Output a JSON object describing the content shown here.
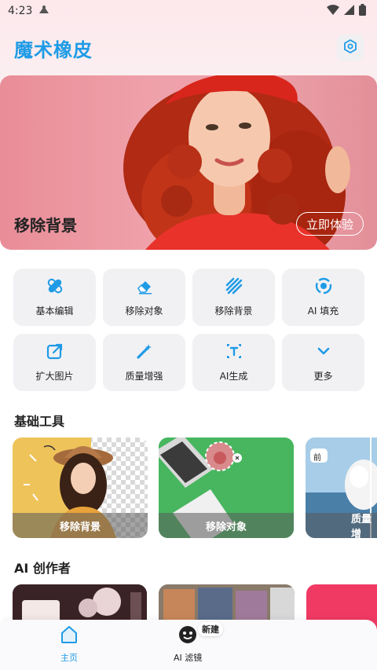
{
  "status_bar": {
    "time": "4:23"
  },
  "header": {
    "title": "魔术橡皮"
  },
  "banner": {
    "title": "移除背景",
    "button_label": "立即体验"
  },
  "tools_grid": [
    {
      "label": "基本编辑",
      "icon": "bandage-icon"
    },
    {
      "label": "移除对象",
      "icon": "eraser-icon"
    },
    {
      "label": "移除背景",
      "icon": "stripes-icon"
    },
    {
      "label": "AI 填充",
      "icon": "fill-icon"
    },
    {
      "label": "扩大图片",
      "icon": "expand-icon"
    },
    {
      "label": "质量增强",
      "icon": "magic-wand-icon"
    },
    {
      "label": "AI生成",
      "icon": "text-cursor-icon"
    },
    {
      "label": "更多",
      "icon": "chevron-down-icon"
    }
  ],
  "basic_tools": {
    "title": "基础工具",
    "cards": [
      {
        "label": "移除背景"
      },
      {
        "label": "移除对象"
      },
      {
        "label": "质量增",
        "before_tag": "前"
      }
    ]
  },
  "ai_creator": {
    "title": "AI 创作者"
  },
  "bottom_nav": {
    "home_label": "主页",
    "filters_label": "AI 滤镜",
    "new_badge": "新建"
  },
  "colors": {
    "accent": "#1f9be6",
    "banner": "#eba1a8",
    "green": "#47b65f"
  }
}
